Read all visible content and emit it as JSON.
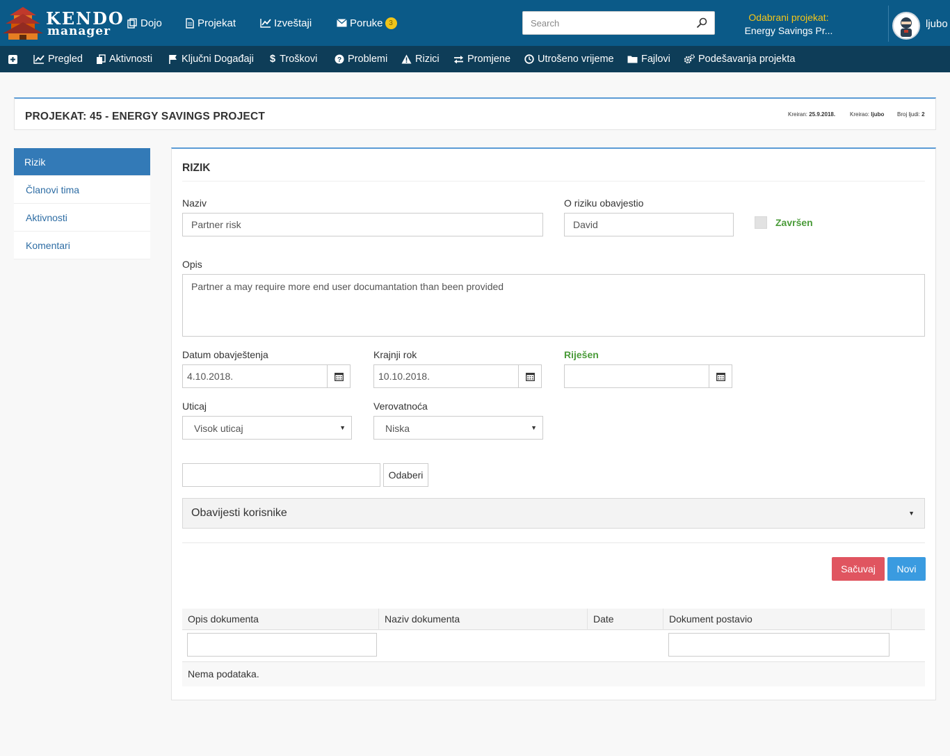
{
  "app": {
    "logo_line1": "KENDO",
    "logo_line2": "manager"
  },
  "topnav": {
    "dojo": "Dojo",
    "projekat": "Projekat",
    "izvestaji": "Izveštaji",
    "poruke": "Poruke",
    "poruke_count": "3"
  },
  "search": {
    "placeholder": "Search"
  },
  "selected_project": {
    "label": "Odabrani projekat:",
    "value": "Energy Savings Pr..."
  },
  "user": {
    "name": "ljubo"
  },
  "subnav": {
    "pregled": "Pregled",
    "aktivnosti": "Aktivnosti",
    "kljucni": "Ključni Događaji",
    "troskovi": "Troškovi",
    "problemi": "Problemi",
    "rizici": "Rizici",
    "promjene": "Promjene",
    "utroseno": "Utrošeno vrijeme",
    "fajlovi": "Fajlovi",
    "podesavanja": "Podešavanja projekta"
  },
  "project": {
    "title": "PROJEKAT: 45 - ENERGY SAVINGS PROJECT",
    "created_label": "Kreiran:",
    "created_value": "25.9.2018.",
    "created_by_label": "Kreirao:",
    "created_by_value": "ljubo",
    "people_label": "Broj ljudi:",
    "people_value": "2"
  },
  "leftmenu": {
    "items": [
      "Rizik",
      "Članovi tima",
      "Aktivnosti",
      "Komentari"
    ]
  },
  "form": {
    "title": "RIZIK",
    "naziv_label": "Naziv",
    "naziv_value": "Partner risk",
    "reporter_label": "O riziku obavjestio",
    "reporter_value": "David",
    "zavrsen_label": "Završen",
    "opis_label": "Opis",
    "opis_value": "Partner a may require more end user documantation than been provided",
    "datum_label": "Datum obavještenja",
    "datum_value": "4.10.2018.",
    "rok_label": "Krajnji rok",
    "rok_value": "10.10.2018.",
    "rijesen_label": "Riješen",
    "rijesen_value": "",
    "uticaj_label": "Uticaj",
    "uticaj_value": "Visok uticaj",
    "verovatnoca_label": "Verovatnoća",
    "verovatnoca_value": "Niska",
    "odaberi_label": "Odaberi",
    "obavijesti_label": "Obavijesti korisnike",
    "save_label": "Sačuvaj",
    "new_label": "Novi"
  },
  "grid": {
    "columns": [
      "Opis dokumenta",
      "Naziv dokumenta",
      "Date",
      "Dokument postavio"
    ],
    "empty_text": "Nema podataka."
  },
  "colors": {
    "topbar": "#0b5a88",
    "subbar": "#0e3d58",
    "accent": "#337ab7",
    "highlight": "#f5c518",
    "green": "#4a9b39",
    "save": "#e05560",
    "new": "#3a9be0"
  },
  "icons": [
    "plus-square-icon",
    "line-chart-icon",
    "copy-icon",
    "flag-icon",
    "dollar-icon",
    "question-circle-icon",
    "warning-icon",
    "exchange-icon",
    "clock-icon",
    "folder-icon",
    "cogs-icon",
    "search-icon",
    "calendar-icon",
    "envelope-icon",
    "file-icon",
    "copy-icon"
  ]
}
